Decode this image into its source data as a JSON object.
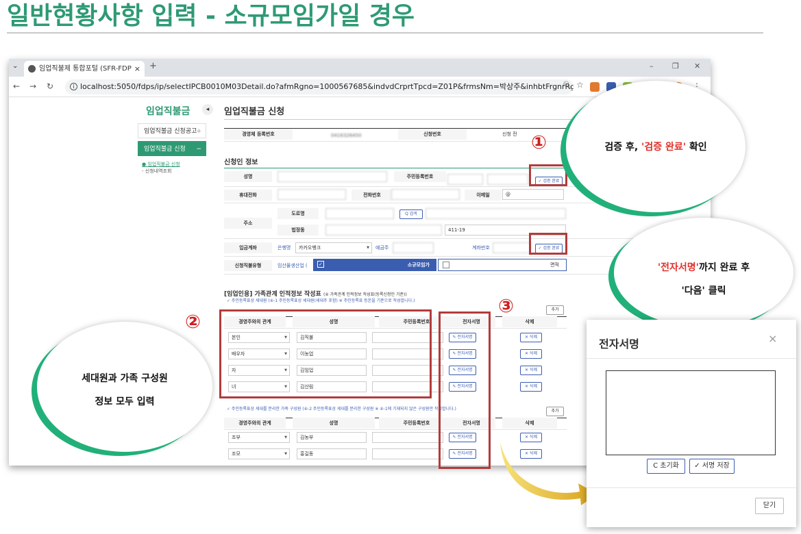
{
  "slide": {
    "title": "일반현황사항 입력 - 소규모임가일 경우"
  },
  "browser": {
    "tab_title": "임업직불제 통합포털 (SFR-FDP",
    "tab_close": "×",
    "new_tab": "+",
    "url": "localhost:5050/fdps/ip/selectIPCB0010M03Detail.do?afmRgno=1000567685&indvdCrprtTpcd=Z01P&frmsNm=박상주&inhbtFrgnrRgno=tFCMBZb..."
  },
  "sidebar": {
    "title": "임업직불금",
    "items": [
      {
        "label": "임업직불금 신청공고",
        "mark": "+"
      },
      {
        "label": "임업직불금 신청",
        "mark": "−"
      }
    ],
    "subitems": [
      "임업직불금 신청",
      "신청내역조회"
    ]
  },
  "main": {
    "title": "임업직불금 신청",
    "top_table": {
      "h1": "경영체 등록번호",
      "v1": "0416326450",
      "h2": "신청번호",
      "h3": "신청 전"
    },
    "applicant_section": "신청인 정보",
    "fields": {
      "name": "성명",
      "rrn": "주민등록번호",
      "mobile": "휴대전화",
      "phone": "전화번호",
      "email": "이메일",
      "email_at": "@",
      "address": "주소",
      "road": "도로명",
      "lot": "법정동",
      "search": "Q 검색",
      "lot_no": "411-19",
      "account": "입금계좌",
      "bank_label": "은행명",
      "bank": "카카오뱅크",
      "holder": "예금주",
      "account_no": "계좌번호",
      "verify": "✓ 검증 완료",
      "type": "신청직불유형",
      "type_v1": "임산물생산업 (",
      "small": "소규모임가",
      "area": "면적"
    },
    "family_section": {
      "title": "[임업인용] 가족관계 인적정보 작성표",
      "note": "(④ 가족관계 인적정보 작성표(등록신청인 기준))",
      "sub1": "✓ 주민등록표상 세대원 (④-1 주민등록표상 세대원(세대주 포함) ※ 주민등록표 등본을 기준으로 작성합니다.)",
      "add": "추가",
      "headers": [
        "경영주와의 관계",
        "성명",
        "주민등록번호",
        "전자서명",
        "삭제"
      ],
      "rows1": [
        {
          "rel": "본인",
          "name": "김직불"
        },
        {
          "rel": "배우자",
          "name": "이농업"
        },
        {
          "rel": "자",
          "name": "김임업"
        },
        {
          "rel": "녀",
          "name": "김산림"
        }
      ],
      "sub2": "✓ 주민등록표상 세대를 분리한 가족 구성원 (④-2 주민등록표상 세대를 분리한 구성원 ※ ④-1에 기재되지 않은 구성원만 작성합니다.)",
      "rows2": [
        {
          "rel": "조부",
          "name": "김농부"
        },
        {
          "rel": "조모",
          "name": "홍길동"
        }
      ],
      "sign_btn": "✎ 전자서명",
      "del_btn": "✕ 삭제"
    }
  },
  "callouts": {
    "c1_pre": "검증 후, ",
    "c1_red": "'검증 완료'",
    "c1_post": " 확인",
    "c2_line1_red": "'전자서명'",
    "c2_line1_post": "까지 완료 후",
    "c2_line2": "'다음' 클릭",
    "c3_line1": "세대원과 가족 구성원",
    "c3_line2": "정보 모두 입력"
  },
  "markers": {
    "m1": "①",
    "m2": "②",
    "m3": "③"
  },
  "dialog": {
    "title": "전자서명",
    "close": "×",
    "reset": "C 초기화",
    "save": "✓ 서명 저장",
    "close_button": "닫기"
  },
  "colors": {
    "accent": "#2e9a73",
    "highlight": "#b23b3b",
    "callout_red": "#e0302a",
    "button_blue": "#3a5db0"
  }
}
